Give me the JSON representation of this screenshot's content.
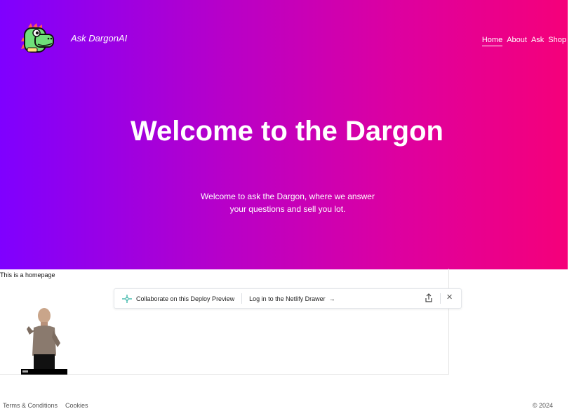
{
  "header": {
    "brand": "Ask DargonAI",
    "logo_icon": "dragon-logo-icon",
    "nav": [
      {
        "label": "Home",
        "active": true
      },
      {
        "label": "About",
        "active": false
      },
      {
        "label": "Ask",
        "active": false
      },
      {
        "label": "Shop",
        "active": false
      }
    ]
  },
  "hero": {
    "title": "Welcome to the Dargon",
    "subtitle": "Welcome to ask the Dargon, where we answer your questions and sell you lot.",
    "gradient_start": "#7f00ff",
    "gradient_end": "#f5007a"
  },
  "main": {
    "body_text": "This is a homepage"
  },
  "netlify_bar": {
    "collab_label": "Collaborate on this Deploy Preview",
    "login_label": "Log in to the Netlify Drawer",
    "arrow": "→",
    "share_icon": "share-icon",
    "close_icon": "close-icon",
    "close_glyph": "✕"
  },
  "footer": {
    "links": [
      "Terms & Conditions",
      "Cookies"
    ],
    "copyright": "© 2024"
  }
}
